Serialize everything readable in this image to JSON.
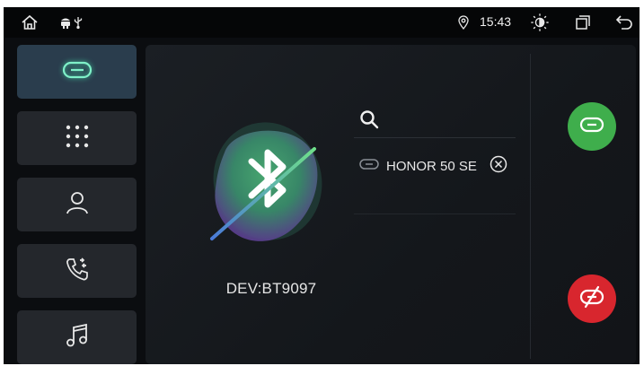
{
  "status_bar": {
    "time": "15:43",
    "icons": [
      "home-icon",
      "android-icon",
      "usb-icon",
      "location-icon",
      "brightness-icon",
      "recent-apps-icon",
      "back-icon"
    ]
  },
  "sidebar": {
    "items": [
      {
        "name": "connections",
        "icon": "link-icon",
        "active": true
      },
      {
        "name": "dialpad",
        "icon": "dialpad-icon",
        "active": false
      },
      {
        "name": "contacts",
        "icon": "contact-icon",
        "active": false
      },
      {
        "name": "call-log",
        "icon": "call-log-icon",
        "active": false
      },
      {
        "name": "music",
        "icon": "music-icon",
        "active": false
      }
    ]
  },
  "main": {
    "device_name": "DEV:BT9097",
    "search_icon": "search-icon",
    "paired_devices": [
      {
        "name": "HONOR 50 SE",
        "icon": "link-icon",
        "remove_icon": "remove-icon"
      }
    ]
  },
  "actions": {
    "connect_icon": "link-icon",
    "disconnect_icon": "unlink-icon"
  },
  "colors": {
    "accent_green": "#3fae4c",
    "danger_red": "#d8262e",
    "active_link": "#7ff0c8",
    "background": "#0b0d10"
  }
}
